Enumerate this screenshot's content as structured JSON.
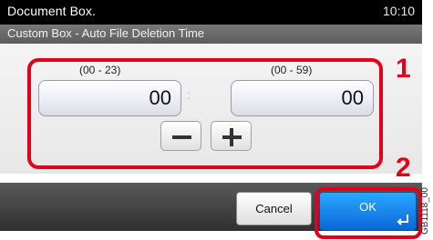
{
  "header": {
    "title": "Document Box.",
    "time": "10:10"
  },
  "subheader": {
    "text": "Custom Box - Auto File Deletion Time"
  },
  "hours": {
    "range": "(00 - 23)",
    "value": "00"
  },
  "minutes": {
    "range": "(00 - 59)",
    "value": "00"
  },
  "separator": ":",
  "callouts": {
    "one": "1",
    "two": "2"
  },
  "footer": {
    "cancel_label": "Cancel",
    "ok_label": "OK"
  },
  "figure_code": "GB1118_00",
  "colors": {
    "accent": "#e3001b",
    "ok_button": "#1a86ec"
  },
  "icons": {
    "minus": "minus-icon",
    "plus": "plus-icon",
    "enter": "enter-return-icon"
  }
}
